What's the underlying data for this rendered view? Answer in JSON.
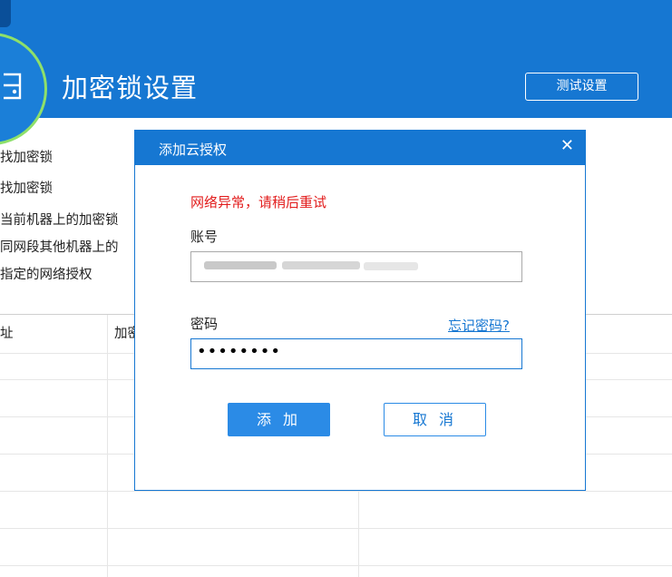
{
  "header": {
    "title": "加密锁设置",
    "test_button": "测试设置"
  },
  "options": [
    "找加密锁",
    "找加密锁",
    "当前机器上的加密锁",
    "同网段其他机器上的",
    "指定的网络授权"
  ],
  "table": {
    "columns": [
      "址",
      "加密"
    ]
  },
  "dialog": {
    "title": "添加云授权",
    "error": "网络异常，请稍后重试",
    "account_label": "账号",
    "password_label": "密码",
    "forgot_password": "忘记密码?",
    "password_mask": "••••••••",
    "add_button": "添 加",
    "cancel_button": "取 消"
  },
  "colors": {
    "header_blue": "#1677d2",
    "error_red": "#e21c1c",
    "ring_green": "#8ee06a"
  }
}
